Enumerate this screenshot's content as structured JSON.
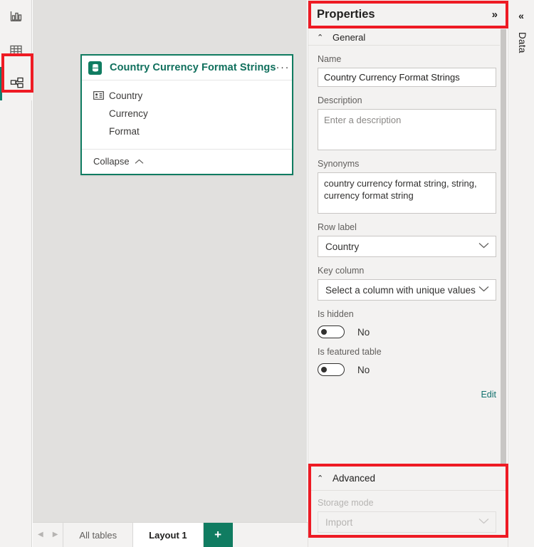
{
  "left_rail": {
    "items": [
      {
        "name": "report-view",
        "icon": "bar-chart-icon",
        "selected": false
      },
      {
        "name": "table-view",
        "icon": "table-grid-icon",
        "selected": false
      },
      {
        "name": "model-view",
        "icon": "model-diagram-icon",
        "selected": true
      }
    ]
  },
  "canvas": {
    "card": {
      "icon": "table-database-icon",
      "title": "Country Currency Format Strings",
      "overflow_menu": "···",
      "fields": [
        {
          "label": "Country",
          "icon": "row-label-id-card-icon",
          "has_icon": true
        },
        {
          "label": "Currency",
          "icon": "",
          "has_icon": false
        },
        {
          "label": "Format",
          "icon": "",
          "has_icon": false
        }
      ],
      "collapse_label": "Collapse",
      "collapse_chevron": "⌃"
    }
  },
  "tabbar": {
    "prev_arrow": "◀",
    "next_arrow": "▶",
    "tabs": [
      {
        "label": "All tables",
        "active": false
      },
      {
        "label": "Layout 1",
        "active": true
      }
    ],
    "add_label": "+"
  },
  "properties": {
    "header": {
      "title": "Properties",
      "collapse_icon": "»"
    },
    "general": {
      "chevron": "⌃",
      "title": "General",
      "name": {
        "caption": "Name",
        "value": "Country Currency Format Strings"
      },
      "description": {
        "caption": "Description",
        "placeholder": "Enter a description",
        "value": ""
      },
      "synonyms": {
        "caption": "Synonyms",
        "value": "country currency format string, string, currency format string"
      },
      "row_label": {
        "caption": "Row label",
        "value": "Country",
        "chevron": "⌄"
      },
      "key_column": {
        "caption": "Key column",
        "value": "Select a column with unique values",
        "chevron": "⌄"
      },
      "is_hidden": {
        "caption": "Is hidden",
        "value": "No",
        "state": "off"
      },
      "is_featured_table": {
        "caption": "Is featured table",
        "value": "No",
        "state": "off"
      },
      "edit_link": "Edit"
    },
    "advanced": {
      "chevron": "⌃",
      "title": "Advanced",
      "storage_mode": {
        "caption": "Storage mode",
        "value": "Import",
        "chevron": "⌄",
        "disabled": true
      }
    }
  },
  "data_rail": {
    "collapse_icon": "«",
    "label": "Data"
  },
  "annotations": {
    "highlight_color": "#ee1b24",
    "boxes": [
      "model-view-rail-button",
      "properties-panel-header",
      "advanced-section"
    ]
  }
}
